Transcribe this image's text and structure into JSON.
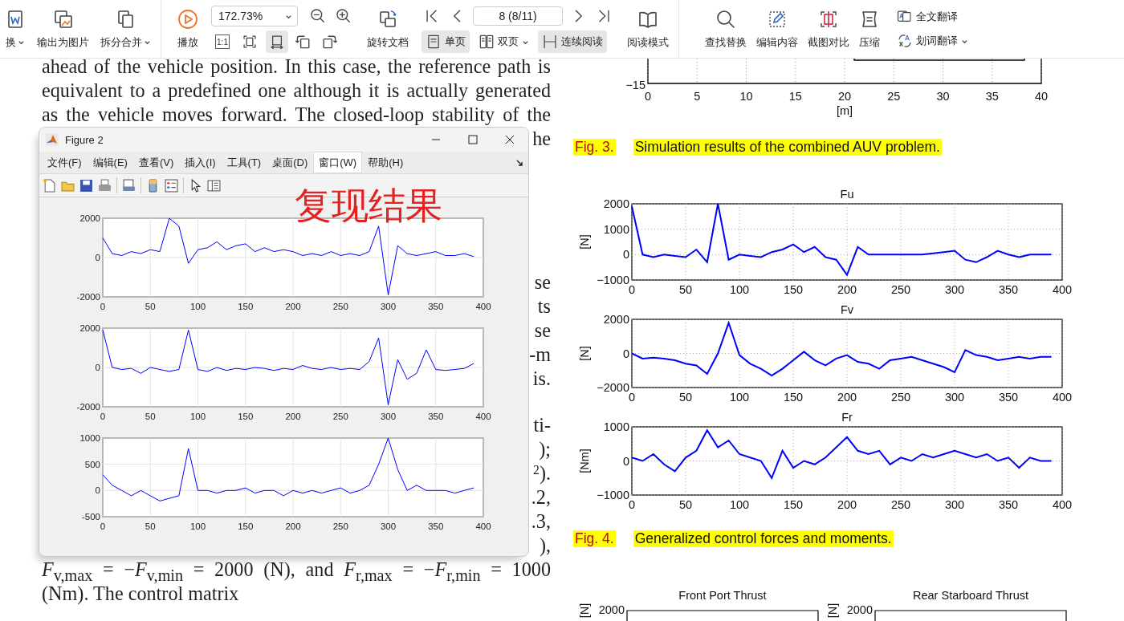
{
  "toolbar": {
    "left_buttons": [
      {
        "label": "换",
        "caret": true
      },
      {
        "label": "输出为图片",
        "caret": false
      },
      {
        "label": "拆分合并",
        "caret": true
      }
    ],
    "play": "播放",
    "zoom": "172.73%",
    "actual_size": "1:1",
    "fit_modes": [
      {
        "selected": false
      },
      {
        "selected": true
      }
    ],
    "rotate_doc": "旋转文档",
    "page": "8 (8/11)",
    "layout_buttons": [
      {
        "label": "单页",
        "selected": true,
        "caret": false
      },
      {
        "label": "双页",
        "selected": false,
        "caret": true
      },
      {
        "label": "连续阅读",
        "selected": true,
        "caret": false
      }
    ],
    "read_mode": "阅读模式",
    "tools": [
      "查找替换",
      "编辑内容",
      "截图对比",
      "压缩"
    ],
    "translate": [
      {
        "label": "全文翻译",
        "caret": false
      },
      {
        "label": "划词翻译",
        "caret": true
      }
    ]
  },
  "document_left": {
    "lines_top": [
      "ahead of the vehicle position. In this case, the reference path is",
      "equivalent to a predefined one although it is actually generated",
      "as the vehicle moves forward. The closed-loop stability of the",
      "he"
    ],
    "fragments_a": [
      "se",
      "ts",
      "se",
      "-m",
      "is."
    ],
    "fragments_b": [
      "ti-",
      ");",
      "$^{2}$).",
      ".2,",
      ".3,",
      "),"
    ],
    "lines_bottom": [
      "*F*$_{v,max}$ = −*F*$_{v,min}$ = 2000 (N), and *F*$_{r,max}$ = −*F*$_{r,min}$ = 1000",
      "(Nm). The control matrix"
    ]
  },
  "figure_window": {
    "title": "Figure 2",
    "menu": [
      {
        "label": "文件(F)",
        "selected": false
      },
      {
        "label": "编辑(E)",
        "selected": false
      },
      {
        "label": "查看(V)",
        "selected": false
      },
      {
        "label": "插入(I)",
        "selected": false
      },
      {
        "label": "工具(T)",
        "selected": false
      },
      {
        "label": "桌面(D)",
        "selected": false
      },
      {
        "label": "窗口(W)",
        "selected": true
      },
      {
        "label": "帮助(H)",
        "selected": false
      }
    ],
    "overlay_text": "复现结果",
    "plots": [
      {
        "chart_data": {
          "type": "line",
          "grid": true,
          "x": [
            0,
            10,
            20,
            30,
            40,
            50,
            60,
            70,
            80,
            90,
            100,
            110,
            120,
            130,
            140,
            150,
            160,
            170,
            180,
            190,
            200,
            210,
            220,
            230,
            240,
            250,
            260,
            270,
            280,
            290,
            300,
            310,
            320,
            330,
            340,
            350,
            360,
            370,
            380,
            390
          ],
          "xlim": [
            0,
            400
          ],
          "ylim": [
            -2000,
            2000
          ],
          "xticks": [
            0,
            50,
            100,
            150,
            200,
            250,
            300,
            350,
            400
          ],
          "yticks": [
            -2000,
            0,
            2000
          ],
          "series": [
            {
              "color": "#0000ff",
              "values": [
                1000,
                200,
                100,
                300,
                200,
                400,
                300,
                2000,
                1600,
                -300,
                400,
                500,
                800,
                400,
                600,
                700,
                300,
                500,
                300,
                400,
                300,
                100,
                200,
                100,
                300,
                100,
                200,
                100,
                300,
                1600,
                -1900,
                600,
                200,
                100,
                200,
                300,
                100,
                100,
                200,
                50
              ]
            }
          ]
        }
      },
      {
        "chart_data": {
          "type": "line",
          "grid": true,
          "x": [
            0,
            10,
            20,
            30,
            40,
            50,
            60,
            70,
            80,
            90,
            100,
            110,
            120,
            130,
            140,
            150,
            160,
            170,
            180,
            190,
            200,
            210,
            220,
            230,
            240,
            250,
            260,
            270,
            280,
            290,
            300,
            310,
            320,
            330,
            340,
            350,
            360,
            370,
            380,
            390
          ],
          "xlim": [
            0,
            400
          ],
          "ylim": [
            -2000,
            2000
          ],
          "xticks": [
            0,
            50,
            100,
            150,
            200,
            250,
            300,
            350,
            400
          ],
          "yticks": [
            -2000,
            0,
            2000
          ],
          "series": [
            {
              "color": "#0000ff",
              "values": [
                1900,
                0,
                -100,
                -50,
                -300,
                0,
                -100,
                -200,
                -100,
                1900,
                -100,
                -200,
                0,
                -150,
                -50,
                -100,
                0,
                -50,
                -150,
                -50,
                -100,
                100,
                -50,
                -100,
                0,
                -100,
                -50,
                -100,
                300,
                1500,
                -1900,
                400,
                -600,
                -300,
                900,
                -100,
                -150,
                -100,
                -50,
                200
              ]
            }
          ]
        }
      },
      {
        "chart_data": {
          "type": "line",
          "grid": true,
          "x": [
            0,
            10,
            20,
            30,
            40,
            50,
            60,
            70,
            80,
            90,
            100,
            110,
            120,
            130,
            140,
            150,
            160,
            170,
            180,
            190,
            200,
            210,
            220,
            230,
            240,
            250,
            260,
            270,
            280,
            290,
            300,
            310,
            320,
            330,
            340,
            350,
            360,
            370,
            380,
            390
          ],
          "xlim": [
            0,
            400
          ],
          "ylim": [
            -500,
            1000
          ],
          "xticks": [
            0,
            50,
            100,
            150,
            200,
            250,
            300,
            350,
            400
          ],
          "yticks": [
            -500,
            0,
            500,
            1000
          ],
          "series": [
            {
              "color": "#0000ff",
              "values": [
                300,
                100,
                0,
                -100,
                0,
                -100,
                -200,
                -150,
                -100,
                800,
                0,
                0,
                -50,
                0,
                0,
                50,
                -50,
                0,
                0,
                -100,
                0,
                -50,
                0,
                -50,
                0,
                50,
                -50,
                0,
                100,
                500,
                1000,
                400,
                0,
                100,
                0,
                0,
                0,
                -50,
                0,
                50
              ]
            }
          ]
        }
      }
    ]
  },
  "document_right": {
    "fig3_axis": {
      "yticks": [
        "−15"
      ],
      "xticks": [
        "0",
        "5",
        "10",
        "15",
        "20",
        "25",
        "30",
        "35",
        "40"
      ],
      "xlabel": "[m]"
    },
    "caption_fig3": {
      "label": "Fig. 3.",
      "text": "Simulation results of the combined AUV problem."
    },
    "plots": [
      {
        "chart_data": {
          "type": "line",
          "grid": true,
          "title": "Fu",
          "ylabel": "[N]",
          "x": [
            0,
            10,
            20,
            30,
            40,
            50,
            60,
            70,
            80,
            90,
            100,
            110,
            120,
            130,
            140,
            150,
            160,
            170,
            180,
            190,
            200,
            210,
            220,
            230,
            240,
            250,
            260,
            270,
            280,
            290,
            300,
            310,
            320,
            330,
            340,
            350,
            360,
            370,
            380,
            390
          ],
          "xlim": [
            0,
            400
          ],
          "ylim": [
            -1000,
            2000
          ],
          "xticks": [
            0,
            50,
            100,
            150,
            200,
            250,
            300,
            350,
            400
          ],
          "yticks": [
            -1000,
            0,
            1000,
            2000
          ],
          "series": [
            {
              "color": "#0000ff",
              "values": [
                1900,
                0,
                -100,
                0,
                -50,
                -100,
                200,
                -300,
                2000,
                -200,
                0,
                -50,
                -100,
                100,
                200,
                400,
                100,
                300,
                -100,
                -200,
                -800,
                300,
                0,
                0,
                0,
                0,
                0,
                0,
                50,
                100,
                150,
                -200,
                -300,
                -100,
                150,
                0,
                -100,
                0,
                0,
                0
              ]
            }
          ]
        }
      },
      {
        "chart_data": {
          "type": "line",
          "grid": true,
          "title": "Fv",
          "ylabel": "[N]",
          "x": [
            0,
            10,
            20,
            30,
            40,
            50,
            60,
            70,
            80,
            90,
            100,
            110,
            120,
            130,
            140,
            150,
            160,
            170,
            180,
            190,
            200,
            210,
            220,
            230,
            240,
            250,
            260,
            270,
            280,
            290,
            300,
            310,
            320,
            330,
            340,
            350,
            360,
            370,
            380,
            390
          ],
          "xlim": [
            0,
            400
          ],
          "ylim": [
            -2000,
            2000
          ],
          "xticks": [
            0,
            50,
            100,
            150,
            200,
            250,
            300,
            350,
            400
          ],
          "yticks": [
            -2000,
            0,
            2000
          ],
          "series": [
            {
              "color": "#0000ff",
              "values": [
                0,
                -300,
                -250,
                -300,
                -400,
                -600,
                -700,
                -1200,
                0,
                1800,
                -100,
                -600,
                -900,
                -1300,
                -900,
                -400,
                100,
                -400,
                -700,
                -300,
                -100,
                -500,
                -600,
                -900,
                -400,
                -300,
                -200,
                -400,
                -600,
                -800,
                -1100,
                200,
                -100,
                -200,
                -400,
                -300,
                -200,
                -300,
                -200,
                -200
              ]
            }
          ]
        }
      },
      {
        "chart_data": {
          "type": "line",
          "grid": true,
          "title": "Fr",
          "ylabel": "[Nm]",
          "x": [
            0,
            10,
            20,
            30,
            40,
            50,
            60,
            70,
            80,
            90,
            100,
            110,
            120,
            130,
            140,
            150,
            160,
            170,
            180,
            190,
            200,
            210,
            220,
            230,
            240,
            250,
            260,
            270,
            280,
            290,
            300,
            310,
            320,
            330,
            340,
            350,
            360,
            370,
            380,
            390
          ],
          "xlim": [
            0,
            400
          ],
          "ylim": [
            -1000,
            1000
          ],
          "xticks": [
            0,
            50,
            100,
            150,
            200,
            250,
            300,
            350,
            400
          ],
          "yticks": [
            -1000,
            0,
            1000
          ],
          "series": [
            {
              "color": "#0000ff",
              "values": [
                100,
                0,
                200,
                -100,
                -300,
                100,
                300,
                900,
                400,
                600,
                200,
                100,
                0,
                -500,
                300,
                -200,
                0,
                -100,
                100,
                400,
                700,
                300,
                200,
                300,
                -100,
                100,
                0,
                200,
                100,
                200,
                300,
                200,
                100,
                200,
                0,
                100,
                -200,
                100,
                0,
                0
              ]
            }
          ]
        }
      }
    ],
    "caption_fig4": {
      "label": "Fig. 4.",
      "text": "Generalized control forces and moments."
    },
    "partial_plots": [
      {
        "title": "Front Port Thrust",
        "ylabel": "[N]",
        "ytick": "2000"
      },
      {
        "title": "Rear Starboard Thrust",
        "ylabel": "[N]",
        "ytick": "2000"
      }
    ]
  }
}
